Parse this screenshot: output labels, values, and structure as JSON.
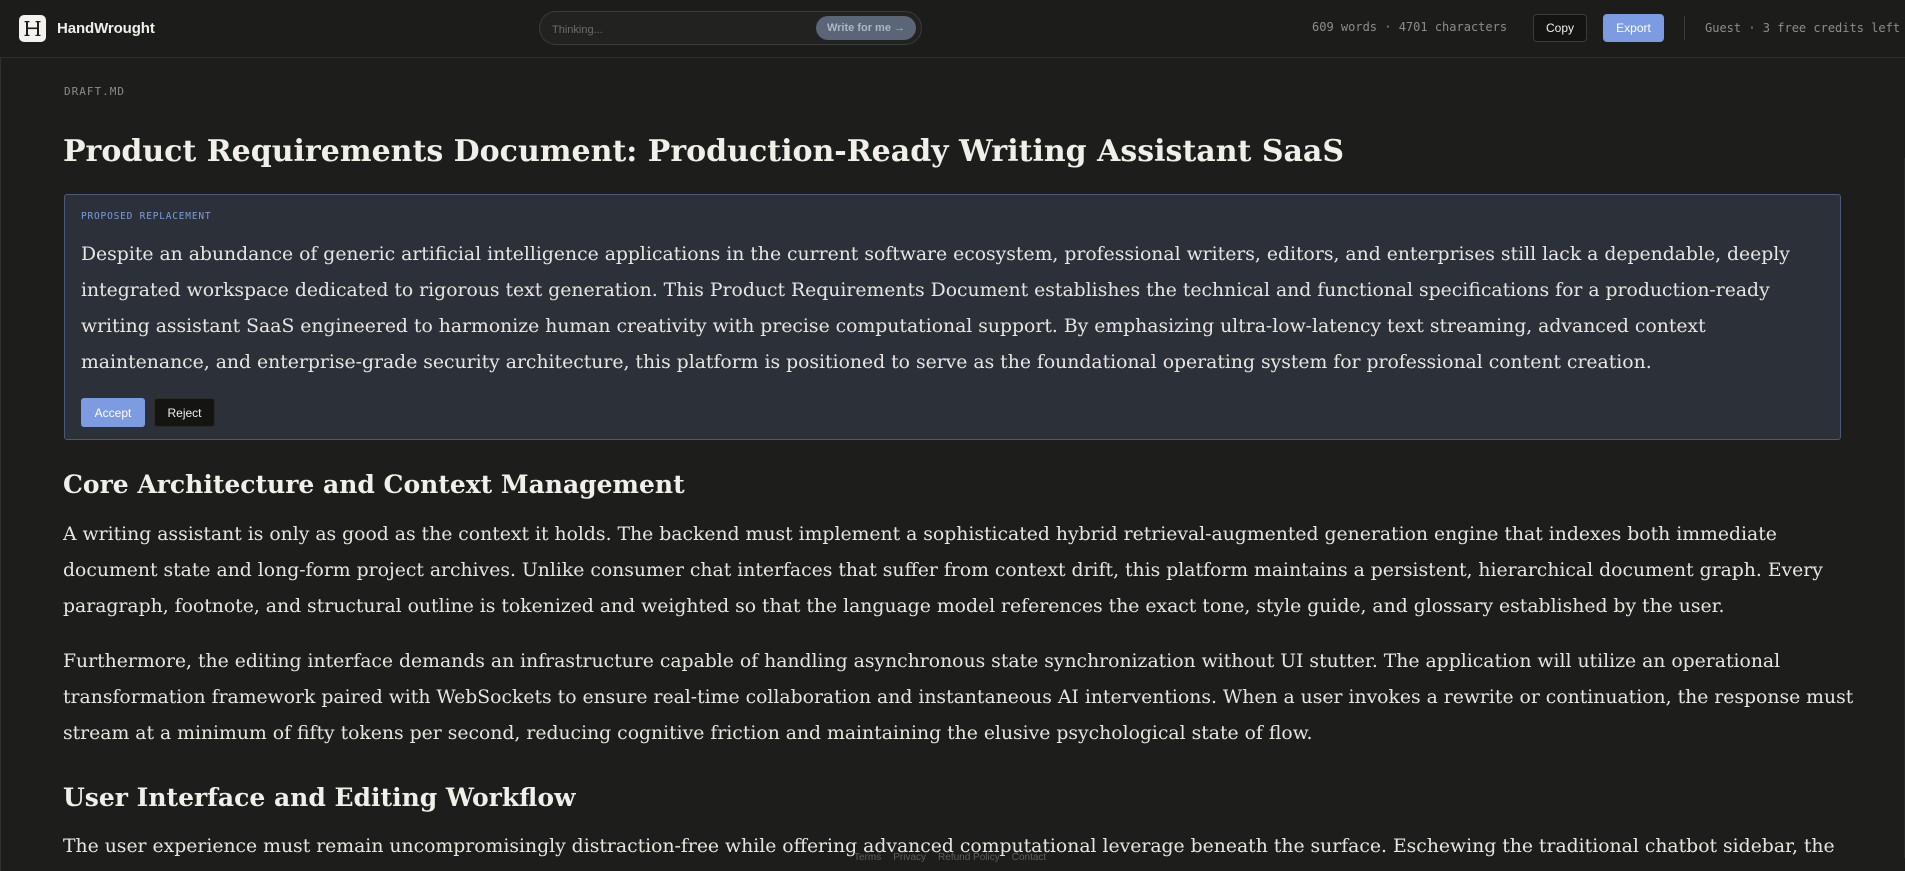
{
  "header": {
    "brand_name": "HandWrought",
    "logo_letter": "H",
    "prompt_placeholder": "Thinking...",
    "write_button_label": "Write for me →",
    "stats": "609 words · 4701 characters",
    "copy_label": "Copy",
    "export_label": "Export",
    "account_status": "Guest · 3 free credits left"
  },
  "document": {
    "file_label": "DRAFT.MD",
    "title": "Product Requirements Document: Production-Ready Writing Assistant SaaS",
    "suggestion": {
      "label": "PROPOSED REPLACEMENT",
      "text": "Despite an abundance of generic artificial intelligence applications in the current software ecosystem, professional writers, editors, and enterprises still lack a dependable, deeply integrated workspace dedicated to rigorous text generation. This Product Requirements Document establishes the technical and functional specifications for a production-ready writing assistant SaaS engineered to harmonize human creativity with precise computational support. By emphasizing ultra-low-latency text streaming, advanced context maintenance, and enterprise-grade security architecture, this platform is positioned to serve as the foundational operating system for professional content creation.",
      "accept_label": "Accept",
      "reject_label": "Reject"
    },
    "sections": [
      {
        "heading": "Core Architecture and Context Management",
        "paragraphs": [
          "A writing assistant is only as good as the context it holds. The backend must implement a sophisticated hybrid retrieval-augmented generation engine that indexes both immediate document state and long-form project archives. Unlike consumer chat interfaces that suffer from context drift, this platform maintains a persistent, hierarchical document graph. Every paragraph, footnote, and structural outline is tokenized and weighted so that the language model references the exact tone, style guide, and glossary established by the user.",
          "Furthermore, the editing interface demands an infrastructure capable of handling asynchronous state synchronization without UI stutter. The application will utilize an operational transformation framework paired with WebSockets to ensure real-time collaboration and instantaneous AI interventions. When a user invokes a rewrite or continuation, the response must stream at a minimum of fifty tokens per second, reducing cognitive friction and maintaining the elusive psychological state of flow."
        ]
      },
      {
        "heading": "User Interface and Editing Workflow",
        "paragraphs": [
          "The user experience must remain uncompromisingly distraction-free while offering advanced computational leverage beneath the surface. Eschewing the traditional chatbot sidebar, the interface"
        ]
      }
    ]
  },
  "footer": {
    "links": [
      "Terms",
      "Privacy",
      "Refund Policy",
      "Contact"
    ]
  },
  "colors": {
    "background": "#1c1c1b",
    "accent": "#7d9be0",
    "suggestion_bg": "#2c3139",
    "suggestion_border": "#4a5a79"
  },
  "icons": {
    "logo": "handwrought-logo-icon",
    "write_arrow": "arrow-right-icon"
  }
}
